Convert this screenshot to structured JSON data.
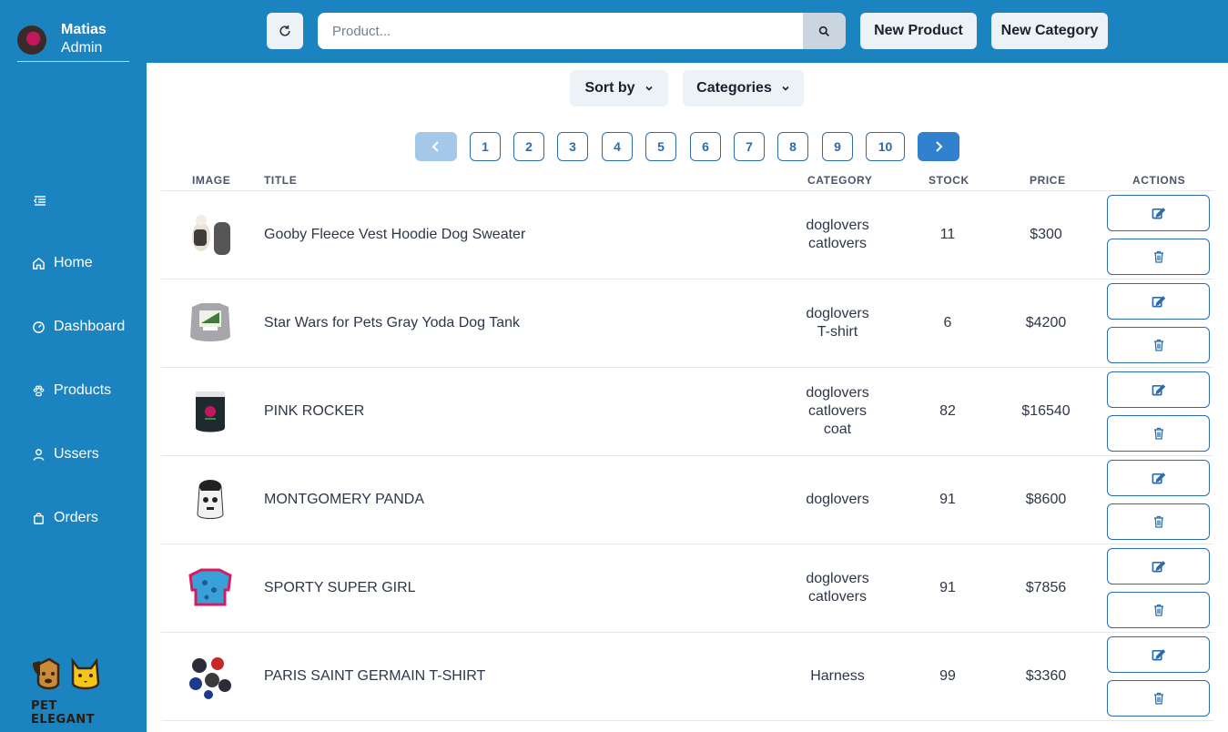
{
  "user": {
    "name": "Matias",
    "role": "Admin"
  },
  "nav": [
    {
      "label": "Home",
      "icon": "home-icon"
    },
    {
      "label": "Dashboard",
      "icon": "gauge-icon"
    },
    {
      "label": "Products",
      "icon": "paw-icon"
    },
    {
      "label": "Ussers",
      "icon": "user-icon"
    },
    {
      "label": "Orders",
      "icon": "bag-icon"
    }
  ],
  "brand": {
    "logo_text": "PET ELEGANT"
  },
  "search": {
    "placeholder": "Product..."
  },
  "toolbar": {
    "new_product": "New Product",
    "new_category": "New Category"
  },
  "filters": {
    "sort_by": "Sort by",
    "categories": "Categories"
  },
  "pagination": {
    "pages": [
      "1",
      "2",
      "3",
      "4",
      "5",
      "6",
      "7",
      "8",
      "9",
      "10"
    ]
  },
  "table": {
    "headers": {
      "image": "IMAGE",
      "title": "TITLE",
      "category": "CATEGORY",
      "stock": "STOCK",
      "price": "PRICE",
      "actions": "ACTIONS"
    },
    "rows": [
      {
        "title": "Gooby Fleece Vest Hoodie Dog Sweater",
        "categories": [
          "doglovers",
          "catlovers"
        ],
        "stock": "11",
        "price": "$300"
      },
      {
        "title": "Star Wars for Pets Gray Yoda Dog Tank",
        "categories": [
          "doglovers",
          "T-shirt"
        ],
        "stock": "6",
        "price": "$4200"
      },
      {
        "title": "PINK ROCKER",
        "categories": [
          "doglovers",
          "catlovers",
          "coat"
        ],
        "stock": "82",
        "price": "$16540"
      },
      {
        "title": "MONTGOMERY PANDA",
        "categories": [
          "doglovers"
        ],
        "stock": "91",
        "price": "$8600"
      },
      {
        "title": "SPORTY SUPER GIRL",
        "categories": [
          "doglovers",
          "catlovers"
        ],
        "stock": "91",
        "price": "$7856"
      },
      {
        "title": "PARIS SAINT GERMAIN T-SHIRT",
        "categories": [
          "Harness"
        ],
        "stock": "99",
        "price": "$3360"
      }
    ]
  },
  "colors": {
    "primary": "#1a83c0",
    "accent": "#2b6cb0",
    "button_bg": "#edf2f7"
  }
}
